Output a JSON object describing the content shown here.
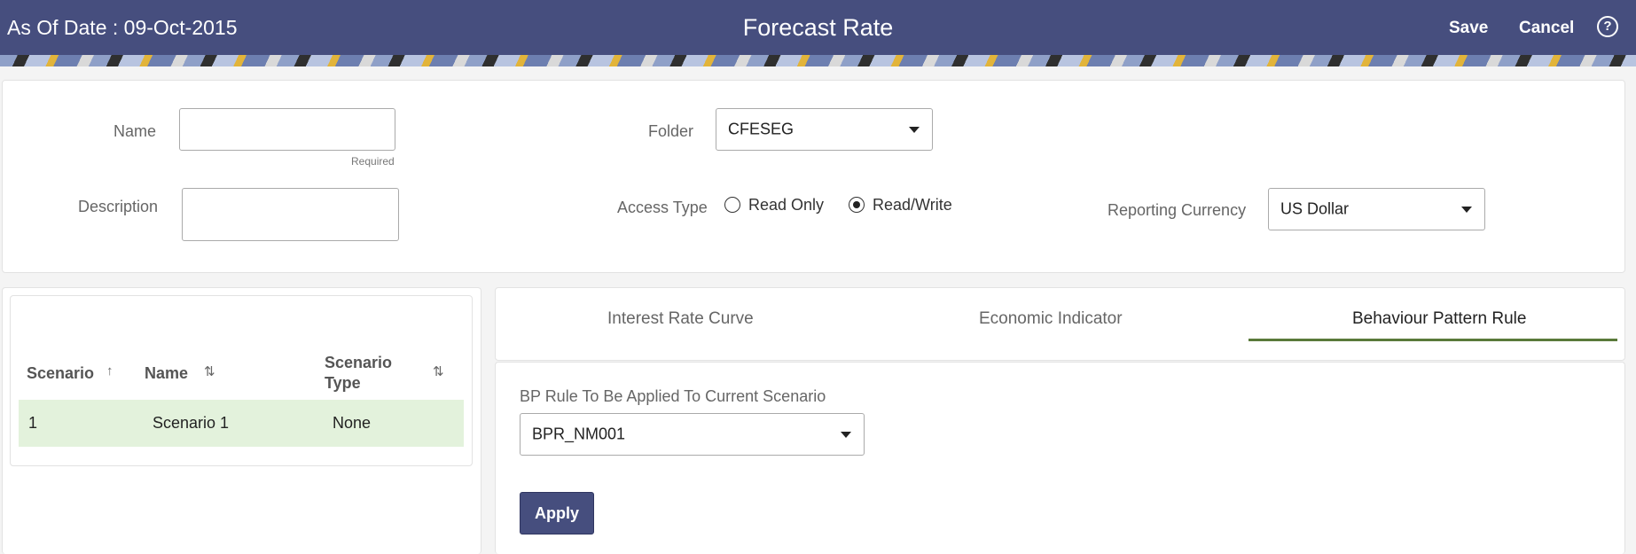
{
  "header": {
    "as_of_date": "As Of Date : 09-Oct-2015",
    "title": "Forecast Rate",
    "save_label": "Save",
    "cancel_label": "Cancel",
    "help_icon": "question-circle-icon",
    "help_glyph": "?"
  },
  "form": {
    "name_label": "Name",
    "name_value": "",
    "required_hint": "Required",
    "description_label": "Description",
    "description_value": "",
    "folder_label": "Folder",
    "folder_value": "CFESEG",
    "access_type_label": "Access Type",
    "access_read_only": "Read Only",
    "access_read_write": "Read/Write",
    "access_selected": "Read/Write",
    "reporting_currency_label": "Reporting Currency",
    "reporting_currency_value": "US Dollar"
  },
  "scenarios": {
    "columns": [
      "Scenario",
      "Name",
      "Scenario Type"
    ],
    "col_scenario": "Scenario",
    "col_name": "Name",
    "col_type_line1": "Scenario",
    "col_type_line2": "Type",
    "sort_asc_glyph": "↑",
    "sort_both_glyph": "⇅",
    "rows": [
      {
        "scenario": "1",
        "name": "Scenario 1",
        "type": "None"
      }
    ]
  },
  "tabs": {
    "items": [
      "Interest Rate Curve",
      "Economic Indicator",
      "Behaviour Pattern Rule"
    ],
    "active": "Behaviour Pattern Rule"
  },
  "bp_rule": {
    "label": "BP Rule To Be Applied To Current Scenario",
    "value": "BPR_NM001",
    "apply_label": "Apply"
  },
  "colors": {
    "header_bg": "#464e7e",
    "selected_row": "#e3f2dc",
    "tab_underline": "#5a7a3a",
    "apply_bg": "#464e7e"
  }
}
